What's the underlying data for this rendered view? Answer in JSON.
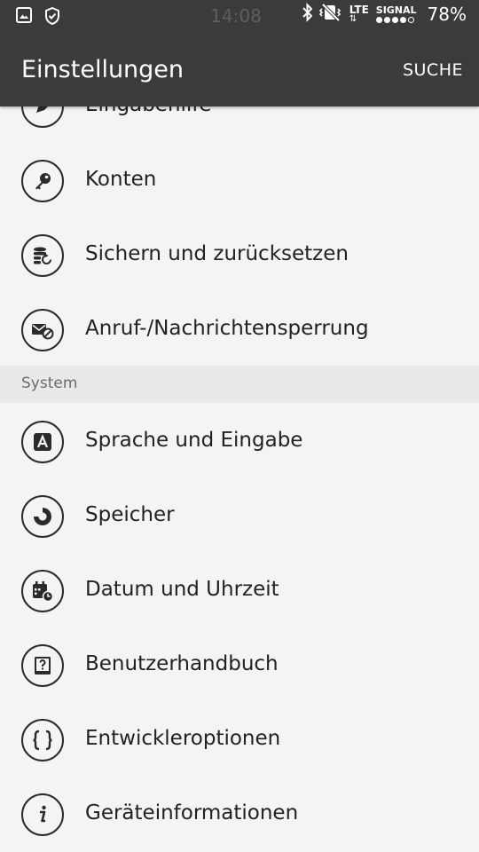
{
  "status_bar": {
    "time": "14:08",
    "network": "LTE",
    "signal_label": "SIGNAL",
    "battery": "78%",
    "icons": [
      "image-icon",
      "shield-icon",
      "bluetooth-icon",
      "vibrate-icon"
    ]
  },
  "app_bar": {
    "title": "Einstellungen",
    "action": "SUCHE"
  },
  "items_top": [
    {
      "label": "Eingabehilfe",
      "icon": "accessibility-icon"
    },
    {
      "label": "Konten",
      "icon": "key-icon"
    },
    {
      "label": "Sichern und zurücksetzen",
      "icon": "backup-icon"
    },
    {
      "label": "Anruf-/Nachrichtensperrung",
      "icon": "block-icon"
    }
  ],
  "section": {
    "label": "System"
  },
  "items_system": [
    {
      "label": "Sprache und Eingabe",
      "icon": "language-icon"
    },
    {
      "label": "Speicher",
      "icon": "storage-icon"
    },
    {
      "label": "Datum und Uhrzeit",
      "icon": "calendar-clock-icon"
    },
    {
      "label": "Benutzerhandbuch",
      "icon": "manual-icon"
    },
    {
      "label": "Entwickleroptionen",
      "icon": "developer-icon"
    },
    {
      "label": "Geräteinformationen",
      "icon": "info-icon"
    }
  ],
  "colors": {
    "bar": "#3b3b3b",
    "background": "#f4f4f4",
    "section": "#e9e9e9"
  }
}
